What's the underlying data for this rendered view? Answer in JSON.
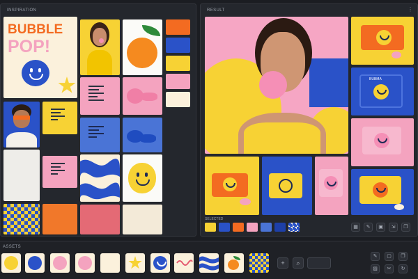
{
  "inspiration": {
    "title": "INSPIRATION",
    "poster_line1": "BUBBLE",
    "poster_line2": "POP!"
  },
  "result": {
    "title": "RESULT",
    "selected_label": "SELECTED",
    "box_brand": "BUBMA"
  },
  "assets": {
    "title": "ASSETS",
    "add_icon": "+",
    "search_icon": "⌕"
  },
  "palette": [
    "#f36b21",
    "#2a52c8",
    "#f7d234",
    "#f4a3bf",
    "#fbf1dc"
  ],
  "colors": {
    "yellow": "#f7d234",
    "blue": "#2a52c8",
    "pink": "#f4a3bf",
    "cream": "#fbf1dc",
    "orange": "#f36b21",
    "navy": "#1d2a54"
  }
}
